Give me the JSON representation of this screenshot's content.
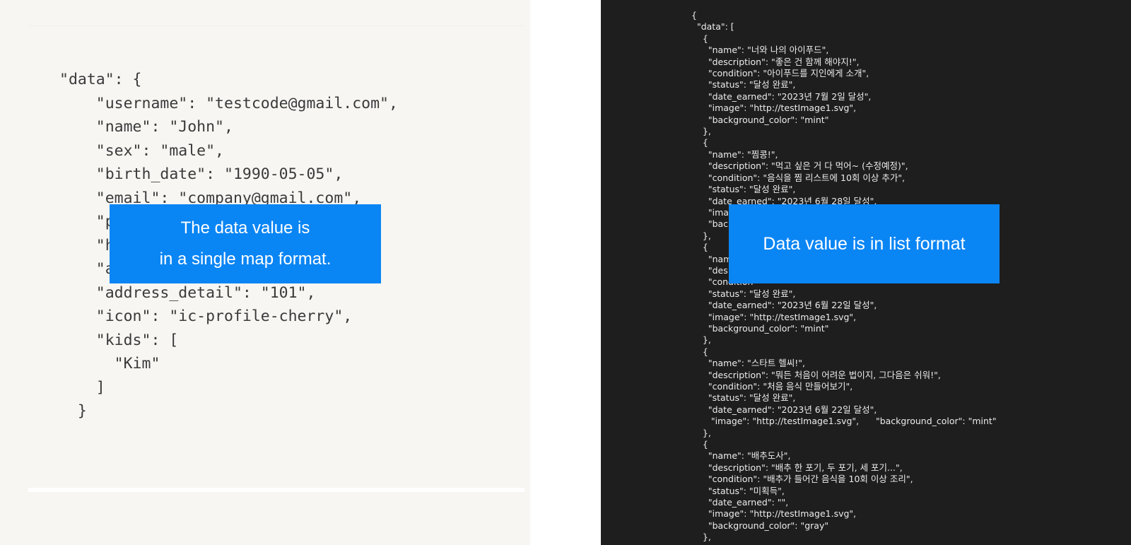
{
  "left": {
    "code": "\"data\": {\n    \"username\": \"testcode@gmail.com\",\n    \"name\": \"John\",\n    \"sex\": \"male\",\n    \"birth_date\": \"1990-05-05\",\n    \"email\": \"company@gmail.com\",\n    \"p\n    \"h\n    \"a\n    \"address_detail\": \"101\",\n    \"icon\": \"ic-profile-cherry\",\n    \"kids\": [\n      \"Kim\"\n    ]\n  }",
    "callout_line1": "The data value is",
    "callout_line2": "in a single map format."
  },
  "right": {
    "code": "{\n  \"data\": [\n    {\n      \"name\": \"너와 나의 아이푸드\",\n      \"description\": \"좋은 건 함께 해야지!\",\n      \"condition\": \"아이푸드를 지인에게 소개\",\n      \"status\": \"달성 완료\",\n      \"date_earned\": \"2023년 7월 2일 달성\",\n      \"image\": \"http://testImage1.svg\",\n      \"background_color\": \"mint\"\n    },\n    {\n      \"name\": \"찜콩!\",\n      \"description\": \"먹고 싶은 거 다 먹어~ (수정예정)\",\n      \"condition\": \"음식을 찜 리스트에 10회 이상 추가\",\n      \"status\": \"달성 완료\",\n      \"date_earned\": \"2023년 6월 28일 달성\",\n      \"ima\n      \"bac\n    },\n    {\n      \"nam\n      \"des\n      \"condition\n      \"status\": \"달성 완료\",\n      \"date_earned\": \"2023년 6월 22일 달성\",\n      \"image\": \"http://testImage1.svg\",\n      \"background_color\": \"mint\"\n    },\n    {\n      \"name\": \"스타트 헬씨!\",\n      \"description\": \"뭐든 처음이 어려운 법이지, 그다음은 쉬워!\",\n      \"condition\": \"처음 음식 만들어보기\",\n      \"status\": \"달성 완료\",\n      \"date_earned\": \"2023년 6월 22일 달성\",\n       \"image\": \"http://testImage1.svg\",      \"background_color\": \"mint\"\n    },\n    {\n      \"name\": \"배추도사\",\n      \"description\": \"배추 한 포기, 두 포기, 세 포기...\",\n      \"condition\": \"배추가 들어간 음식을 10회 이상 조리\",\n      \"status\": \"미획득\",\n      \"date_earned\": \"\",\n      \"image\": \"http://testImage1.svg\",\n      \"background_color\": \"gray\"\n    },",
    "callout": "Data value is in list format"
  }
}
